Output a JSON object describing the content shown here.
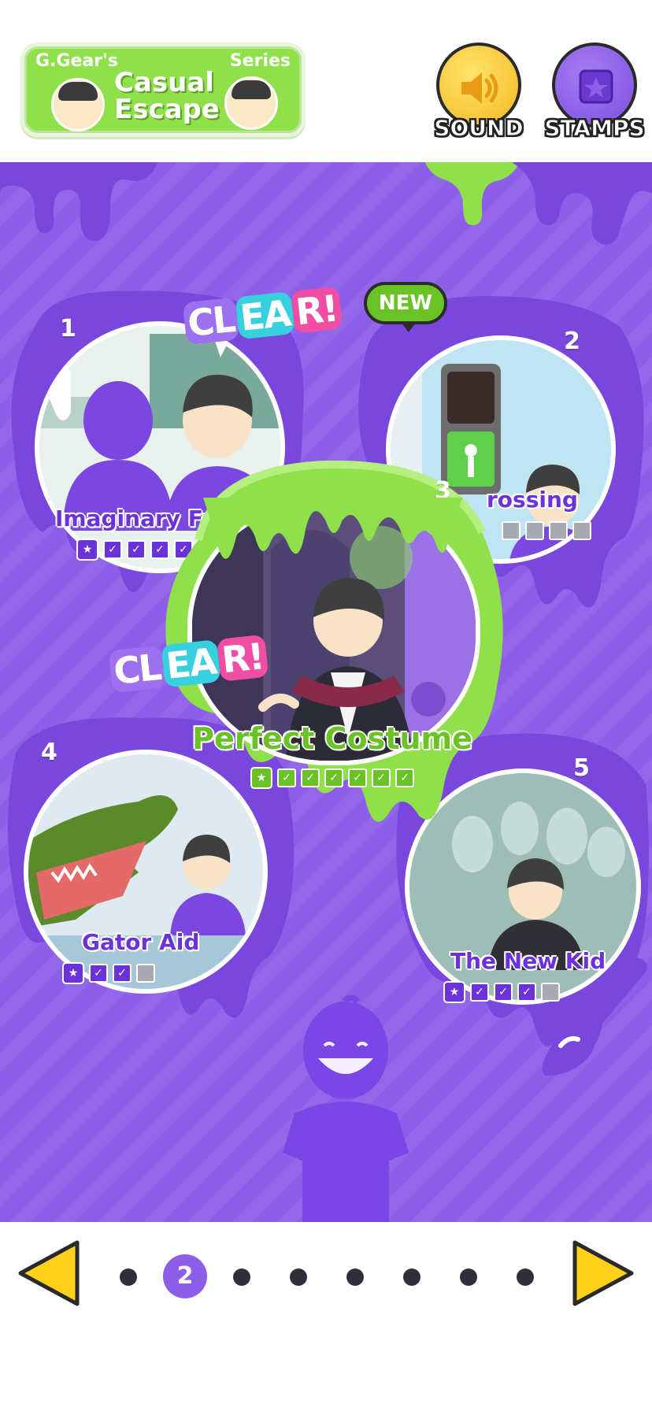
{
  "header": {
    "logo": {
      "brand": "G.Gear's",
      "series": "Series",
      "title_line1": "Casual",
      "title_line2": "Escape"
    },
    "sound_label": "SOUND",
    "stamps_label": "STAMPS",
    "sound_icon": "speaker-icon",
    "stamps_icon": "stamp-icon"
  },
  "levels": [
    {
      "number": "1",
      "title": "Imaginary Fri",
      "cleared": true,
      "clear_text": [
        "CL",
        "EA",
        "R!"
      ],
      "checks_done": 6,
      "checks_total": 6
    },
    {
      "number": "2",
      "title": "rossing",
      "is_new": true,
      "new_label": "NEW",
      "checks_done": 0,
      "checks_total": 4
    },
    {
      "number": "3",
      "title": "Perfect Costume",
      "cleared": true,
      "clear_text": [
        "CL",
        "EA",
        "R!"
      ],
      "checks_done": 6,
      "checks_total": 6,
      "selected": true
    },
    {
      "number": "4",
      "title": "Gator Aid",
      "checks_done": 2,
      "checks_total": 3
    },
    {
      "number": "5",
      "title": "The New Kid",
      "checks_done": 3,
      "checks_total": 4
    }
  ],
  "pager": {
    "current_page": "2",
    "total_pages": 8
  },
  "colors": {
    "purple": "#8d5fe8",
    "deep_purple": "#6a32d8",
    "slime_green": "#8fe04a",
    "arrow_yellow": "#ffd11a"
  }
}
